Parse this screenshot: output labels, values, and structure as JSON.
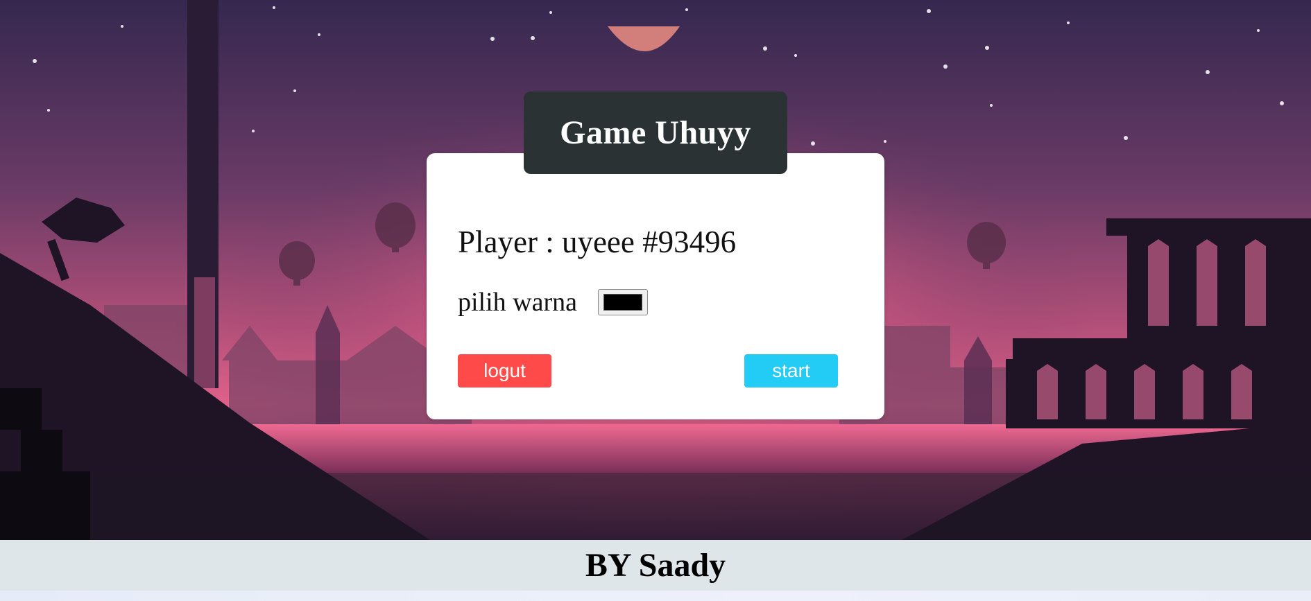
{
  "app": {
    "title": "Game Uhuyy"
  },
  "card": {
    "player_label": "Player : uyeee #93496",
    "color_label": "pilih warna",
    "color_value": "#000000",
    "logout_label": "logut",
    "start_label": "start"
  },
  "footer": {
    "text": "BY Saady"
  },
  "colors": {
    "title_bg": "#2b3234",
    "logout_bg": "#ff4a4a",
    "start_bg": "#22ccf4",
    "footer_bg": "#dfe6ea",
    "sky_top": "#3a2a55",
    "sky_glow": "#f06a8e",
    "silhouette": "#1e1425"
  }
}
